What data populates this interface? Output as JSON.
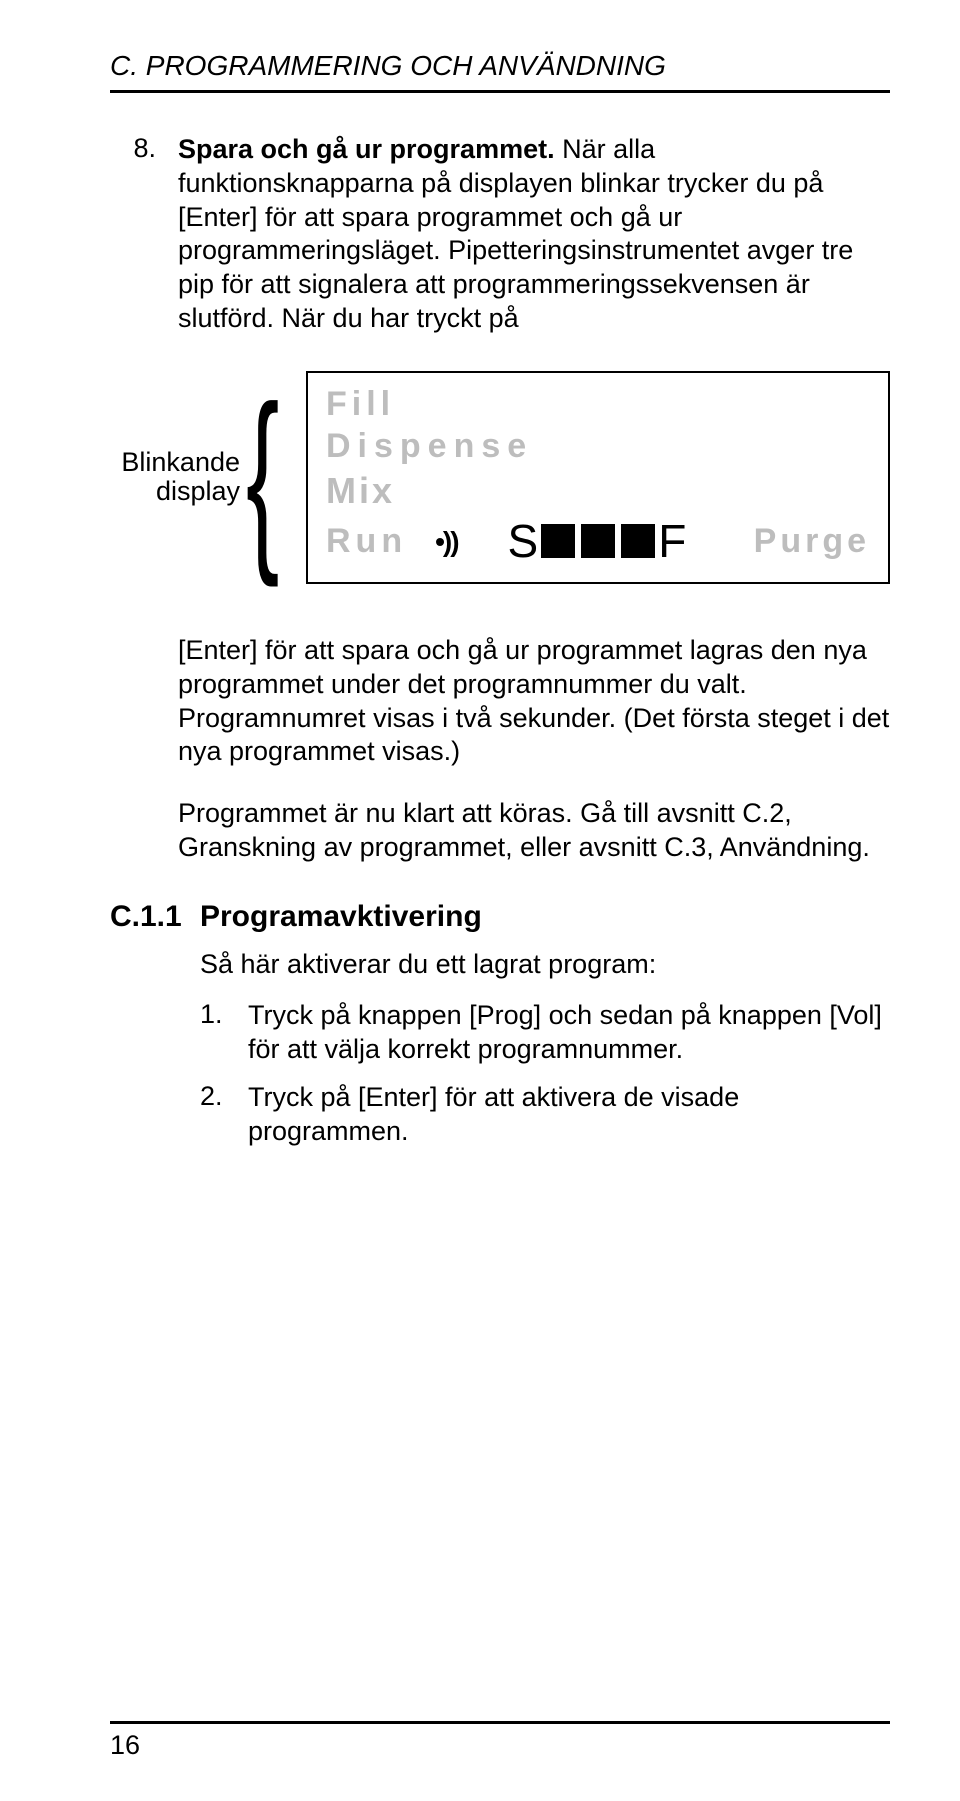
{
  "header": "C. PROGRAMMERING OCH ANVÄNDNING",
  "step8": {
    "num": "8.",
    "title": "Spara och gå ur programmet.",
    "text": " När alla funktionsknapparna på displayen blinkar trycker du på [Enter] för att spara programmet och gå ur programmeringsläget. Pipetteringsinstrumentet avger tre pip för att signalera att programmeringssekvensen är slutförd. När du har tryckt på"
  },
  "blink_label_line1": "Blinkande",
  "blink_label_line2": "display",
  "display": {
    "fill": "Fill",
    "dispense": "Dispense",
    "mix": "Mix",
    "run": "Run",
    "s": "S",
    "f": "F",
    "purge": "Purge"
  },
  "after_display_p1": "[Enter] för att spara och gå ur programmet lagras den nya programmet under det programnummer du valt. Programnumret visas i två sekunder. (Det första steget i det nya programmet visas.)",
  "after_display_p2": "Programmet är nu klart att köras. Gå till avsnitt C.2, Granskning av programmet, eller avsnitt C.3, Användning.",
  "subsection": {
    "num": "C.1.1",
    "title": "Programavktivering",
    "intro": "Så här aktiverar du ett lagrat program:",
    "item1_num": "1.",
    "item1_text": "Tryck på knappen [Prog] och sedan på knappen [Vol] för att välja korrekt programnummer.",
    "item2_num": "2.",
    "item2_text": "Tryck på [Enter] för att aktivera de visade programmen."
  },
  "page_number": "16"
}
